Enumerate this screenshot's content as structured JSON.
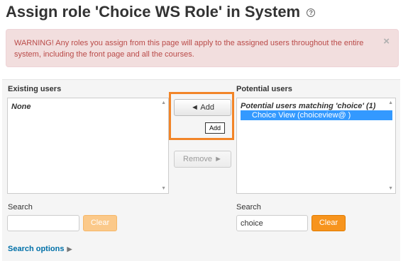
{
  "page": {
    "title": "Assign role 'Choice WS Role' in System",
    "help_icon": "?"
  },
  "alert": {
    "text": "WARNING! Any roles you assign from this page will apply to the assigned users throughout the entire system, including the front page and all the courses.",
    "close_label": "×"
  },
  "existing": {
    "label": "Existing users",
    "none_option": "None",
    "search_label": "Search",
    "search_value": "",
    "clear_label": "Clear"
  },
  "actions": {
    "add_label": "◄ Add",
    "remove_label": "Remove ►",
    "tooltip": "Add"
  },
  "potential": {
    "label": "Potential users",
    "group_label": "Potential users matching 'choice' (1)",
    "selected_user": "Choice View (choiceview@        )",
    "search_label": "Search",
    "search_value": "choice",
    "clear_label": "Clear"
  },
  "footer": {
    "search_options_label": "Search options",
    "caret": "▶"
  },
  "colors": {
    "alert_bg": "#f2dede",
    "alert_text": "#b94a48",
    "highlight": "#f28528",
    "selected_bg": "#3399ff",
    "clear_button": "#f7941d",
    "link": "#0070a8"
  }
}
